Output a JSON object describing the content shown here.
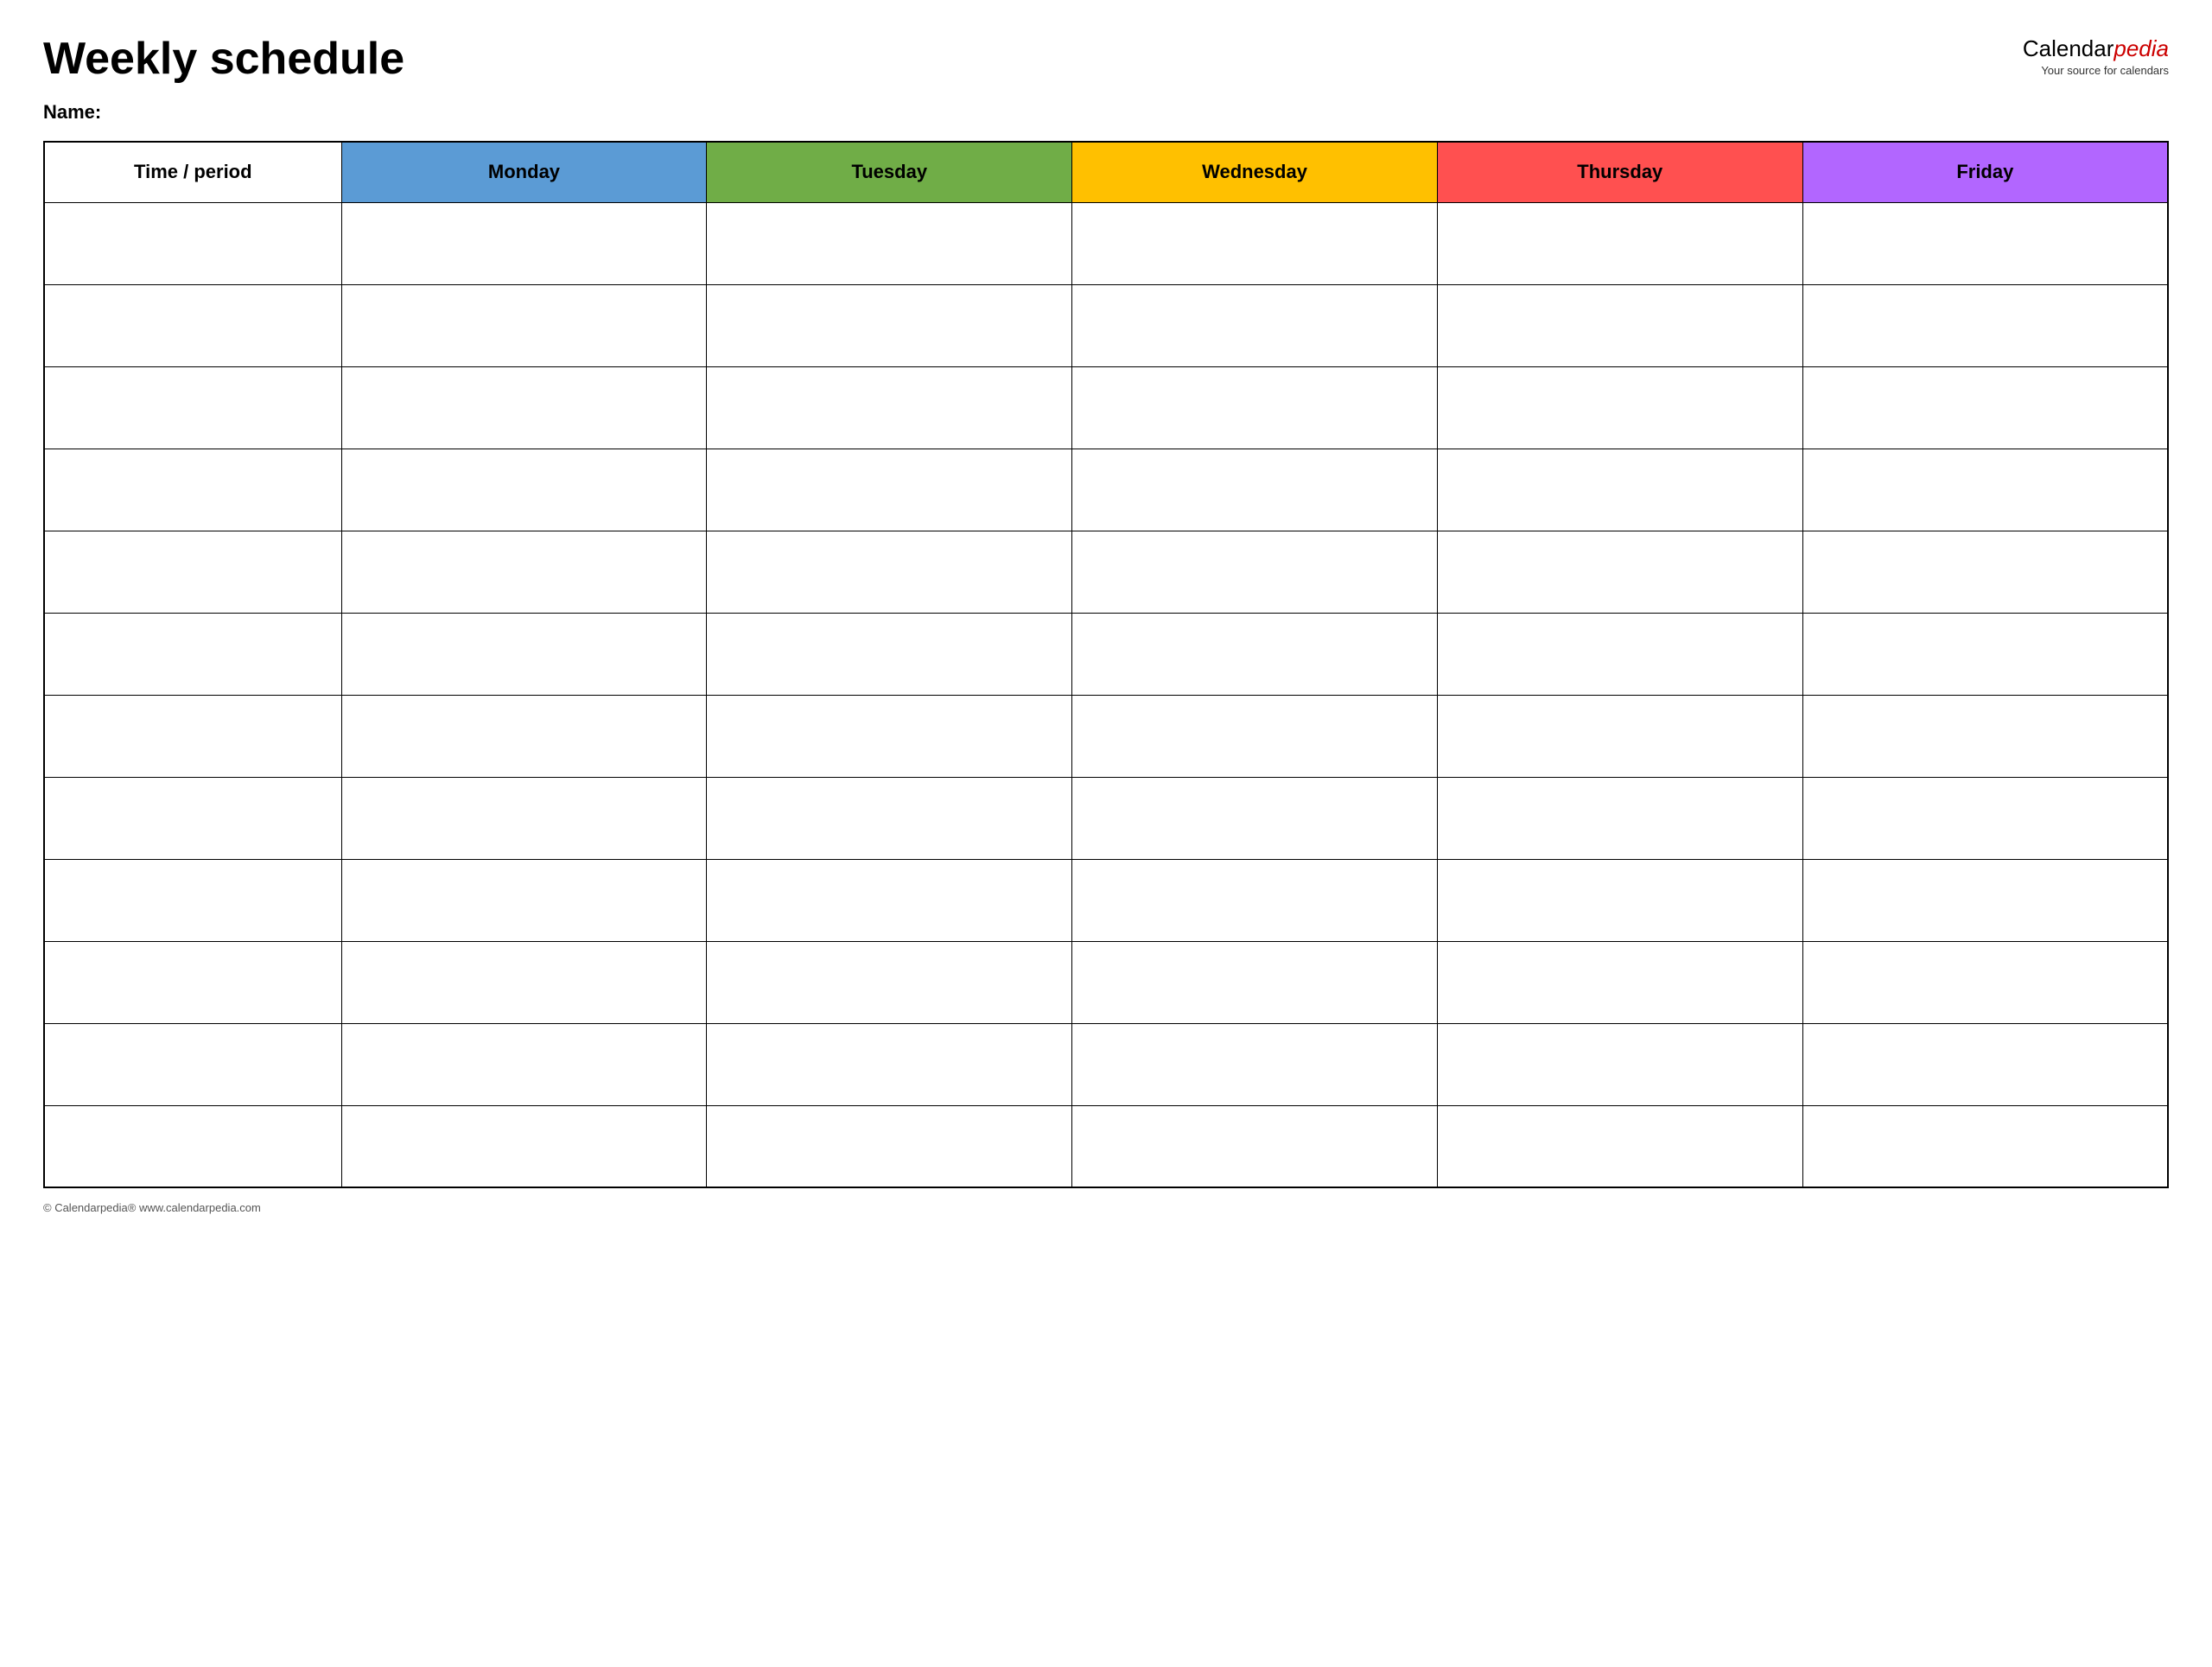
{
  "header": {
    "title": "Weekly schedule",
    "brand": {
      "name_plain": "Calendar",
      "name_styled": "pedia",
      "tagline": "Your source for calendars"
    }
  },
  "name_label": "Name:",
  "table": {
    "columns": [
      {
        "id": "time",
        "label": "Time / period",
        "color": "#ffffff"
      },
      {
        "id": "monday",
        "label": "Monday",
        "color": "#5b9bd5"
      },
      {
        "id": "tuesday",
        "label": "Tuesday",
        "color": "#70ad47"
      },
      {
        "id": "wednesday",
        "label": "Wednesday",
        "color": "#ffc000"
      },
      {
        "id": "thursday",
        "label": "Thursday",
        "color": "#ff5050"
      },
      {
        "id": "friday",
        "label": "Friday",
        "color": "#b266ff"
      }
    ],
    "row_count": 12
  },
  "footer": {
    "text": "© Calendarpedia®  www.calendarpedia.com"
  }
}
